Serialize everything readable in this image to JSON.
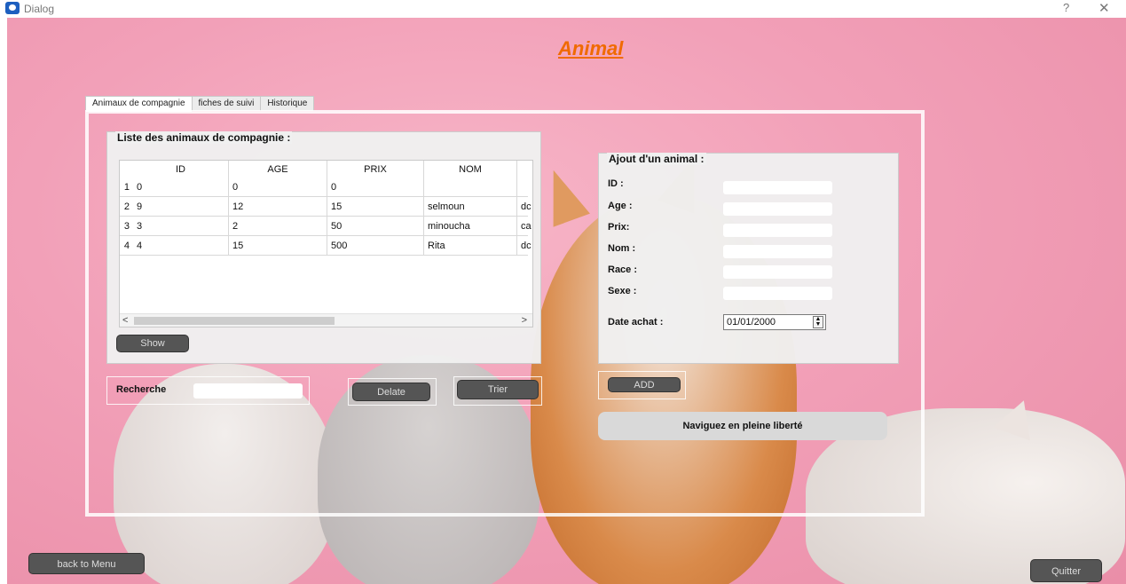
{
  "window": {
    "title": "Dialog",
    "help": "?",
    "close": "✕"
  },
  "heading": "Animal",
  "tabs": [
    {
      "label": "Animaux de compagnie",
      "active": true
    },
    {
      "label": "fiches de suivi",
      "active": false
    },
    {
      "label": "Historique",
      "active": false
    }
  ],
  "list_group": {
    "title": "Liste des animaux de compagnie :",
    "columns": [
      "ID",
      "AGE",
      "PRIX",
      "NOM",
      ""
    ],
    "rows": [
      {
        "num": "1",
        "cells": [
          "0",
          "0",
          "0",
          "",
          ""
        ]
      },
      {
        "num": "2",
        "cells": [
          "9",
          "12",
          "15",
          "selmoun",
          "dc"
        ]
      },
      {
        "num": "3",
        "cells": [
          "3",
          "2",
          "50",
          "minoucha",
          "ca"
        ]
      },
      {
        "num": "4",
        "cells": [
          "4",
          "15",
          "500",
          "Rita",
          "dc"
        ]
      }
    ],
    "scroll_left": "<",
    "scroll_right": ">",
    "show_label": "Show"
  },
  "search": {
    "label": "Recherche",
    "value": ""
  },
  "delete_label": "Delate",
  "sort_label": "Trier",
  "add_group": {
    "title": "Ajout d'un animal :",
    "fields": [
      {
        "label": "ID :",
        "value": ""
      },
      {
        "label": "Age :",
        "value": ""
      },
      {
        "label": "Prix:",
        "value": ""
      },
      {
        "label": "Nom :",
        "value": ""
      },
      {
        "label": "Race :",
        "value": ""
      },
      {
        "label": "Sexe :",
        "value": ""
      }
    ],
    "date_label": "Date achat :",
    "date_value": "01/01/2000"
  },
  "add_label": "ADD",
  "banner": "Naviguez en pleine liberté",
  "back_label": "back to Menu",
  "quit_label": "Quitter"
}
